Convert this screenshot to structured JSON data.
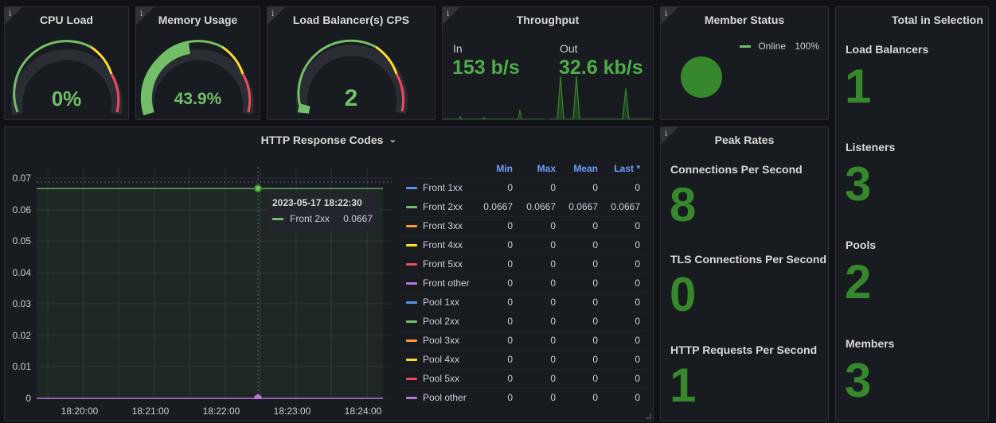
{
  "colors": {
    "green": "#73bf69",
    "dark_green": "#37872d",
    "yellow": "#fade2a",
    "red": "#f2495c",
    "blue": "#5794f2",
    "orange": "#ff9830",
    "purple": "#b877d9"
  },
  "icons": {
    "info": "info-icon",
    "chevron": "chevron-down-icon"
  },
  "cpu": {
    "title": "CPU Load",
    "value": "0%",
    "info": "i",
    "fraction": 0
  },
  "memory": {
    "title": "Memory Usage",
    "value": "43.9%",
    "info": "i",
    "fraction": 0.439
  },
  "lbcps": {
    "title": "Load Balancer(s) CPS",
    "value": "2",
    "info": "i"
  },
  "throughput": {
    "title": "Throughput",
    "info": "i",
    "in_label": "In",
    "in_value": "153 b/s",
    "out_label": "Out",
    "out_value": "32.6 kb/s"
  },
  "member_status": {
    "title": "Member Status",
    "info": "i",
    "legend": [
      {
        "name": "Online",
        "percent": "100%"
      }
    ]
  },
  "total": {
    "title": "Total in Selection",
    "items": [
      {
        "label": "Load Balancers",
        "value": "1"
      },
      {
        "label": "Listeners",
        "value": "3"
      },
      {
        "label": "Pools",
        "value": "2"
      },
      {
        "label": "Members",
        "value": "3"
      }
    ]
  },
  "http": {
    "title": "HTTP Response Codes",
    "chevron": "⌄",
    "legend_headers": {
      "min": "Min",
      "max": "Max",
      "mean": "Mean",
      "last": "Last *"
    },
    "legend": [
      {
        "name": "Front 1xx",
        "color": "#5794f2",
        "min": "0",
        "max": "0",
        "mean": "0",
        "last": "0"
      },
      {
        "name": "Front 2xx",
        "color": "#73bf69",
        "min": "0.0667",
        "max": "0.0667",
        "mean": "0.0667",
        "last": "0.0667"
      },
      {
        "name": "Front 3xx",
        "color": "#ff9830",
        "min": "0",
        "max": "0",
        "mean": "0",
        "last": "0"
      },
      {
        "name": "Front 4xx",
        "color": "#fade2a",
        "min": "0",
        "max": "0",
        "mean": "0",
        "last": "0"
      },
      {
        "name": "Front 5xx",
        "color": "#f2495c",
        "min": "0",
        "max": "0",
        "mean": "0",
        "last": "0"
      },
      {
        "name": "Front other",
        "color": "#b877d9",
        "min": "0",
        "max": "0",
        "mean": "0",
        "last": "0"
      },
      {
        "name": "Pool 1xx",
        "color": "#5794f2",
        "min": "0",
        "max": "0",
        "mean": "0",
        "last": "0"
      },
      {
        "name": "Pool 2xx",
        "color": "#73bf69",
        "min": "0",
        "max": "0",
        "mean": "0",
        "last": "0"
      },
      {
        "name": "Pool 3xx",
        "color": "#ff9830",
        "min": "0",
        "max": "0",
        "mean": "0",
        "last": "0"
      },
      {
        "name": "Pool 4xx",
        "color": "#fade2a",
        "min": "0",
        "max": "0",
        "mean": "0",
        "last": "0"
      },
      {
        "name": "Pool 5xx",
        "color": "#f2495c",
        "min": "0",
        "max": "0",
        "mean": "0",
        "last": "0"
      },
      {
        "name": "Pool other",
        "color": "#b877d9",
        "min": "0",
        "max": "0",
        "mean": "0",
        "last": "0"
      }
    ],
    "tooltip": {
      "time": "2023-05-17 18:22:30",
      "series": "Front 2xx",
      "value": "0.0667"
    }
  },
  "peak": {
    "title": "Peak Rates",
    "info": "i",
    "items": [
      {
        "label": "Connections Per Second",
        "value": "8"
      },
      {
        "label": "TLS Connections Per Second",
        "value": "0"
      },
      {
        "label": "HTTP Requests Per Second",
        "value": "1"
      }
    ]
  },
  "chart_data": {
    "type": "line",
    "title": "HTTP Response Codes",
    "xlabel": "",
    "ylabel": "",
    "x_ticks": [
      "18:20:00",
      "18:21:00",
      "18:22:00",
      "18:23:00",
      "18:24:00"
    ],
    "y_ticks": [
      "0.07",
      "0.06",
      "0.05",
      "0.04",
      "0.03",
      "0.02",
      "0.01",
      "0"
    ],
    "ylim": [
      0,
      0.07
    ],
    "grid": true,
    "legend_placement": "right",
    "series": [
      {
        "name": "Front 2xx",
        "color": "#73bf69",
        "x": [
          "18:19:30",
          "18:24:30"
        ],
        "values": [
          0.0667,
          0.0667
        ]
      },
      {
        "name": "Front other",
        "color": "#b877d9",
        "x": [
          "18:19:30",
          "18:24:30"
        ],
        "values": [
          0,
          0
        ]
      }
    ],
    "hover_time": "18:22:30"
  }
}
